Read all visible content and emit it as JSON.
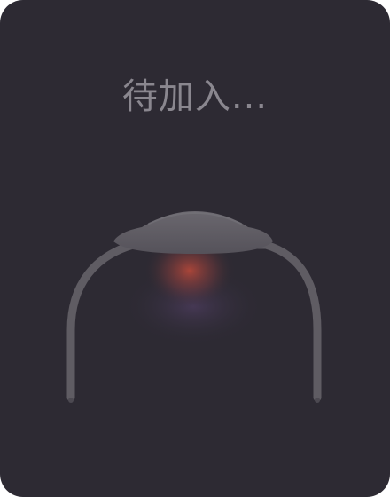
{
  "status": {
    "text": "待加入..."
  },
  "illustration": {
    "icon": "headband-device-icon",
    "colors": {
      "background": "#2d2a33",
      "device": "#5f5c63",
      "text": "#8a878f",
      "glow_red": "#c04a3a",
      "glow_purple": "#5a4470"
    }
  }
}
